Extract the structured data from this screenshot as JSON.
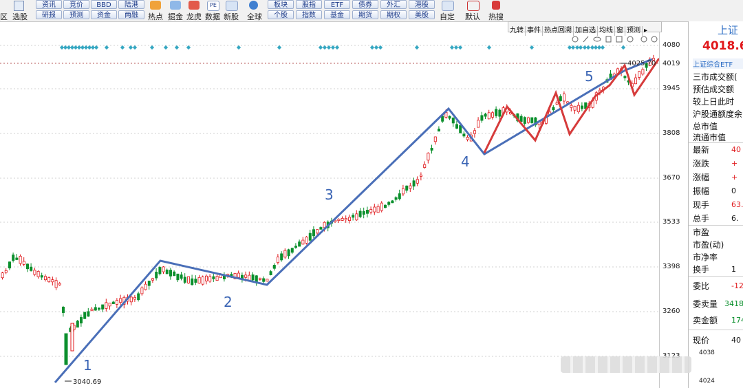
{
  "toolbar": {
    "left_item": "区",
    "select_stock": "选股",
    "buttons_row1": [
      "资讯",
      "竞价",
      "BBD",
      "陆港"
    ],
    "buttons_row2": [
      "研报",
      "预测",
      "资金",
      "两融"
    ],
    "icons": [
      "热点",
      "掘金",
      "龙虎",
      "数据",
      "新股",
      "全球"
    ],
    "buttons2_row1": [
      "板块",
      "股指",
      "ETF",
      "债券",
      "外汇",
      "港股"
    ],
    "buttons2_row2": [
      "个股",
      "指数",
      "基金",
      "期货",
      "期权",
      "美股"
    ],
    "right_icons": [
      "自定",
      "默认",
      "热搜"
    ]
  },
  "chart_toolbar": [
    "九转",
    "事件",
    "热点回溯",
    "加自选",
    "均线",
    "窗",
    "预测"
  ],
  "price_axis": [
    "4080",
    "4019",
    "3945",
    "3808",
    "3670",
    "3533",
    "3398",
    "3260",
    "3123",
    "4038",
    "4024"
  ],
  "annotations": {
    "high_label": "4025.70",
    "low_label": "3040.69",
    "waves": [
      "1",
      "2",
      "3",
      "4",
      "5"
    ]
  },
  "side_panel": {
    "title": "上证",
    "price": "4018.6",
    "subtitle": "上证综合ETF",
    "info_rows": [
      "三市成交额(",
      "预估成交额",
      "较上日此时",
      "沪股通额度余",
      "总市值",
      "流通市值"
    ],
    "quote_rows": [
      {
        "label": "最新",
        "value": "40"
      },
      {
        "label": "涨跌",
        "value": "+"
      },
      {
        "label": "涨幅",
        "value": "+"
      },
      {
        "label": "振幅",
        "value": "0"
      },
      {
        "label": "现手",
        "value": "63."
      },
      {
        "label": "总手",
        "value": "6."
      }
    ],
    "ratio_rows": [
      {
        "label": "市盈",
        "value": ""
      },
      {
        "label": "市盈(动)",
        "value": ""
      },
      {
        "label": "市净率",
        "value": ""
      },
      {
        "label": "换手",
        "value": "1"
      }
    ],
    "order_rows": [
      {
        "label": "委比",
        "value": "-12"
      },
      {
        "label": "委卖量",
        "value": "3418."
      },
      {
        "label": "卖金额",
        "value": "174."
      }
    ],
    "current_label": "现价",
    "current_value": "40"
  },
  "colors": {
    "up": "#e0181b",
    "down": "#0a8f2c",
    "wave_blue": "#4a6fb8",
    "wave_red": "#d63b3b",
    "dot": "#35a7c2"
  }
}
